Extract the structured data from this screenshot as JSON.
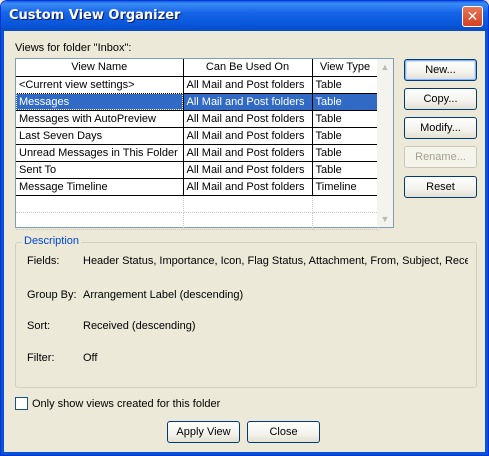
{
  "window": {
    "title": "Custom View Organizer",
    "close_glyph": "✕"
  },
  "views_label": "Views for folder \"Inbox\":",
  "table": {
    "headers": [
      "View Name",
      "Can Be Used On",
      "View Type"
    ],
    "rows": [
      [
        "<Current view settings>",
        "All Mail and Post folders",
        "Table"
      ],
      [
        "Messages",
        "All Mail and Post folders",
        "Table"
      ],
      [
        "Messages with AutoPreview",
        "All Mail and Post folders",
        "Table"
      ],
      [
        "Last Seven Days",
        "All Mail and Post folders",
        "Table"
      ],
      [
        "Unread Messages in This Folder",
        "All Mail and Post folders",
        "Table"
      ],
      [
        "Sent To",
        "All Mail and Post folders",
        "Table"
      ],
      [
        "Message Timeline",
        "All Mail and Post folders",
        "Timeline"
      ]
    ],
    "selected_index": 1
  },
  "buttons": {
    "new": "New...",
    "copy": "Copy...",
    "modify": "Modify...",
    "rename": "Rename...",
    "reset": "Reset",
    "apply_view": "Apply View",
    "close": "Close"
  },
  "description": {
    "title": "Description",
    "fields_label": "Fields:",
    "fields_value": "Header Status, Importance, Icon, Flag Status, Attachment, From, Subject, Rece",
    "group_by_label": "Group By:",
    "group_by_value": "Arrangement Label (descending)",
    "sort_label": "Sort:",
    "sort_value": "Received (descending)",
    "filter_label": "Filter:",
    "filter_value": "Off"
  },
  "only_show_label": "Only show views created for this folder",
  "icons": {
    "close": "close-icon",
    "scroll_up": "scroll-up-arrow-icon",
    "scroll_down": "scroll-down-arrow-icon"
  },
  "colors": {
    "titlebar": "#0653d6",
    "selection": "#316ac5",
    "group_title": "#0046d5",
    "face": "#ece9d8"
  }
}
